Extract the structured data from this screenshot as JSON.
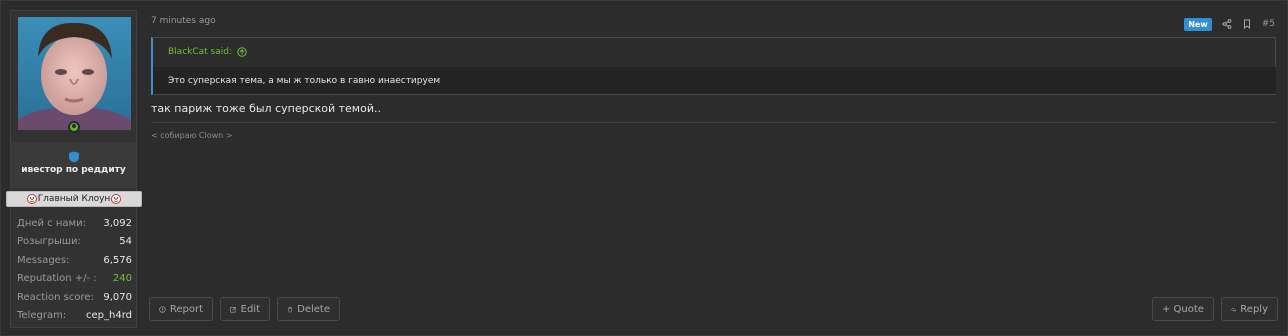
{
  "user": {
    "title": "ивестор по реддиту",
    "banner": "Главный Клоун",
    "stats": [
      {
        "label": "Дней с нами:",
        "value": "3,092"
      },
      {
        "label": "Розыгрыши:",
        "value": "54"
      },
      {
        "label": "Messages:",
        "value": "6,576"
      },
      {
        "label": "Reputation +/- :",
        "value": "240"
      },
      {
        "label": "Reaction score:",
        "value": "9,070"
      },
      {
        "label": "Telegram:",
        "value": "cep_h4rd"
      }
    ]
  },
  "message": {
    "time": "7 minutes ago",
    "badge": "New",
    "post_number": "#5",
    "quote": {
      "author": "BlackCat said:",
      "text": "Это суперская тема, а мы ж только в гавно инаестируем"
    },
    "text": "так париж тоже был суперской темой..",
    "signature": "< собираю Clown >"
  },
  "actions": {
    "report": "Report",
    "edit": "Edit",
    "delete": "Delete",
    "quote": "+ Quote",
    "reply": "Reply"
  },
  "colors": {
    "background": "#2b2b2b",
    "accent_blue": "#3c8fd6",
    "online_green": "#63b32a",
    "reputation_green": "#6fbf3a"
  }
}
